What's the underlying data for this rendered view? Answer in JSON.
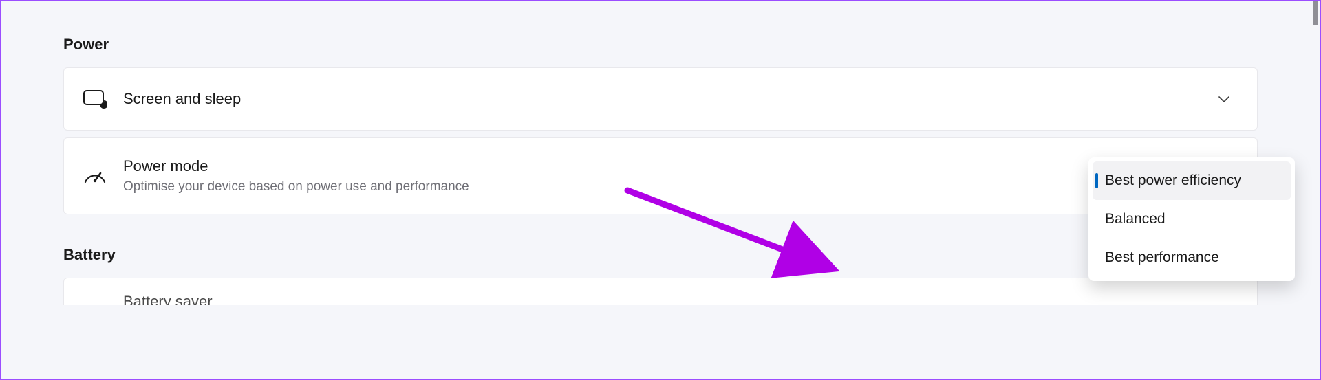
{
  "sections": {
    "power": {
      "heading": "Power",
      "items": [
        {
          "title": "Screen and sleep",
          "subtitle": ""
        },
        {
          "title": "Power mode",
          "subtitle": "Optimise your device based on power use and performance"
        }
      ]
    },
    "battery": {
      "heading": "Battery",
      "items": [
        {
          "title": "Battery saver"
        }
      ]
    }
  },
  "dropdown": {
    "options": [
      {
        "label": "Best power efficiency",
        "selected": true
      },
      {
        "label": "Balanced",
        "selected": false
      },
      {
        "label": "Best performance",
        "selected": false
      }
    ]
  },
  "colors": {
    "accent": "#0067c0",
    "annotation": "#b000e6",
    "border": "#9b4dff"
  }
}
